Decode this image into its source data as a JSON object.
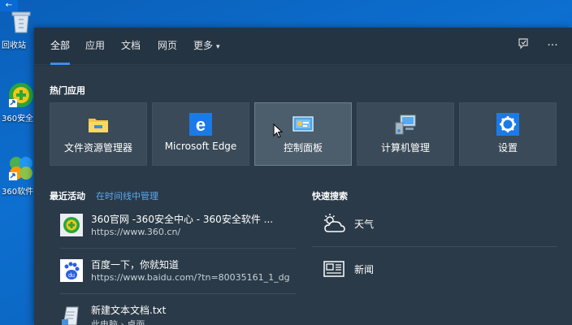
{
  "desktop": {
    "back_arrow": "←",
    "icons": [
      {
        "label": "回收站"
      },
      {
        "label": "360安全"
      },
      {
        "label": "360软件"
      }
    ]
  },
  "search": {
    "tabs": [
      {
        "label": "全部",
        "active": true
      },
      {
        "label": "应用"
      },
      {
        "label": "文档"
      },
      {
        "label": "网页"
      },
      {
        "label": "更多"
      }
    ],
    "more_caret": "▾",
    "feedback_icon": "⚑",
    "more_options": "···",
    "hot_apps": {
      "title": "热门应用",
      "items": [
        {
          "label": "文件资源管理器",
          "icon": "folder-icon"
        },
        {
          "label": "Microsoft Edge",
          "icon": "edge-icon"
        },
        {
          "label": "控制面板",
          "icon": "control-panel-icon"
        },
        {
          "label": "计算机管理",
          "icon": "computer-management-icon"
        },
        {
          "label": "设置",
          "icon": "gear-icon"
        }
      ]
    },
    "recent": {
      "title": "最近活动",
      "manage_link": "在时间线中管理",
      "items": [
        {
          "title": "360官网 -360安全中心 - 360安全软件 ...",
          "url": "https://www.360.cn/",
          "icon": "360-icon"
        },
        {
          "title": "百度一下，你就知道",
          "url": "https://www.baidu.com/?tn=80035161_1_dg",
          "icon": "baidu-icon"
        },
        {
          "title": "新建文本文档.txt",
          "url": "此电脑 › 桌面",
          "icon": "text-file-icon"
        }
      ]
    },
    "quick": {
      "title": "快速搜索",
      "items": [
        {
          "label": "天气",
          "icon": "weather-icon"
        },
        {
          "label": "新闻",
          "icon": "news-icon"
        }
      ]
    }
  },
  "colors": {
    "accent": "#3b8de8",
    "panel": "#253443",
    "tile": "#3a4a58",
    "link": "#5aa9f0"
  }
}
